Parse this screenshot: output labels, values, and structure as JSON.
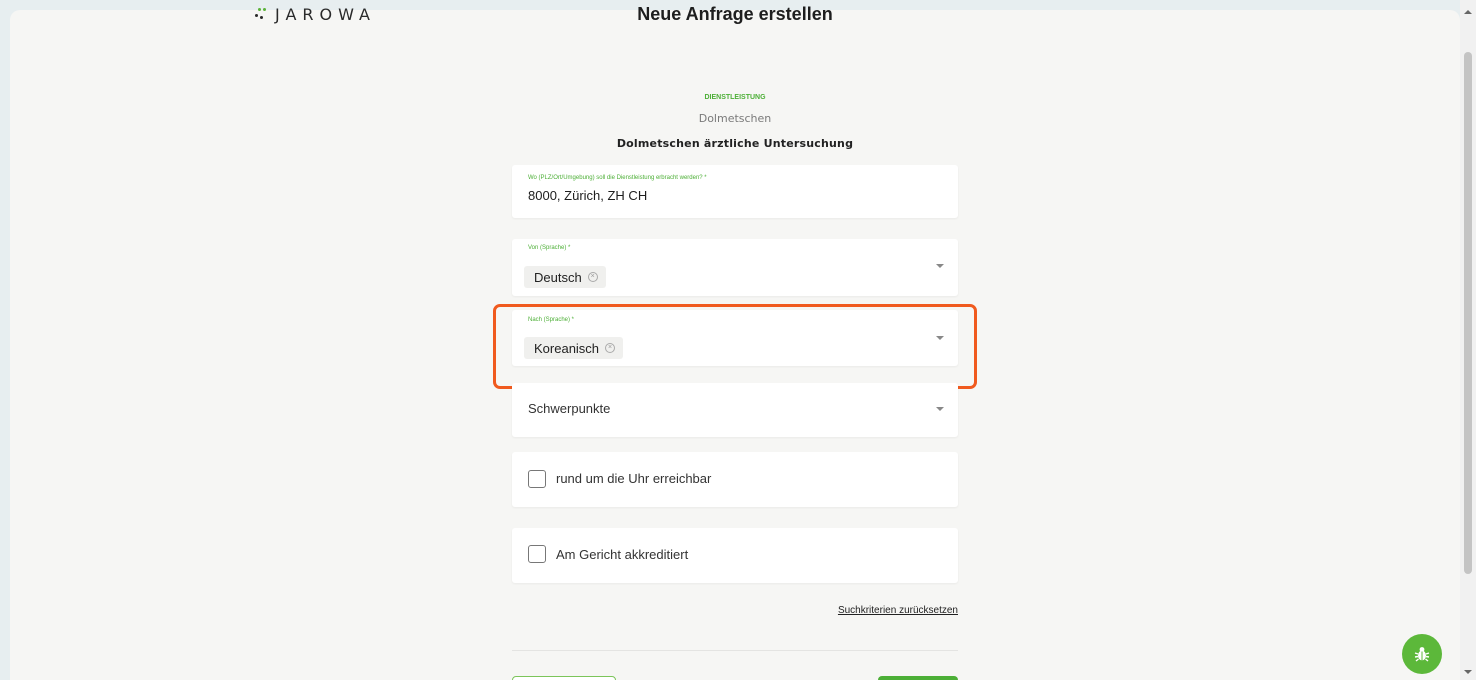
{
  "header": {
    "logo_text": "JAROWA",
    "title": "Neue Anfrage erstellen"
  },
  "category": {
    "label": "DIENSTLEISTUNG",
    "value": "Dolmetschen"
  },
  "service_title": "Dolmetschen ärztliche Untersuchung",
  "location": {
    "label": "Wo (PLZ/Ort/Umgebung) soll die Dienstleistung erbracht werden? *",
    "value": "8000, Zürich, ZH CH"
  },
  "from_language": {
    "label": "Von (Sprache) *",
    "selected": "Deutsch"
  },
  "to_language": {
    "label": "Nach (Sprache) *",
    "selected": "Koreanisch"
  },
  "focus": {
    "placeholder": "Schwerpunkte"
  },
  "options": {
    "around_clock": "rund um die Uhr erreichbar",
    "court_accredited": "Am Gericht akkreditiert"
  },
  "reset_link": "Suchkriterien zurücksetzen",
  "colors": {
    "accent_green": "#4caf36",
    "highlight_orange": "#f05a1e"
  },
  "icons": {
    "chip_remove": "circle-x-icon",
    "dropdown": "caret-down-icon",
    "bug_report": "bug-icon"
  }
}
